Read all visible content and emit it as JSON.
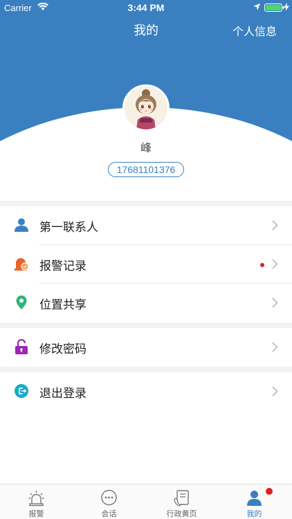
{
  "status_bar": {
    "carrier": "Carrier",
    "time": "3:44 PM"
  },
  "nav": {
    "title": "我的",
    "right_action": "个人信息"
  },
  "profile": {
    "name": "峰",
    "phone": "17681101376",
    "avatar_icon": "avatar-cartoon-girl"
  },
  "menu": {
    "groups": [
      [
        {
          "label": "第一联系人",
          "icon": "person-icon",
          "color": "#3a80c0"
        },
        {
          "label": "报警记录",
          "icon": "alarm-record-icon",
          "color": "#e8642a",
          "has_dot": true
        },
        {
          "label": "位置共享",
          "icon": "location-pin-icon",
          "color": "#2bb673"
        }
      ],
      [
        {
          "label": "修改密码",
          "icon": "lock-icon",
          "color": "#9c27b0"
        }
      ],
      [
        {
          "label": "退出登录",
          "icon": "logout-icon",
          "color": "#1aa9c8"
        }
      ]
    ]
  },
  "tabs": [
    {
      "label": "报警",
      "icon": "alarm-icon"
    },
    {
      "label": "会话",
      "icon": "chat-icon"
    },
    {
      "label": "行政黄页",
      "icon": "yellow-pages-icon"
    },
    {
      "label": "我的",
      "icon": "profile-icon",
      "active": true,
      "badge": true
    }
  ],
  "colors": {
    "primary": "#3a80c0",
    "badge_red": "#e02020"
  }
}
